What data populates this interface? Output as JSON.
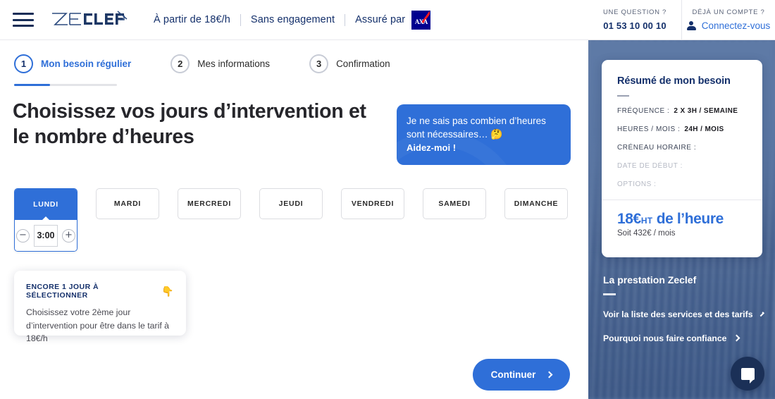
{
  "header": {
    "logo_text": "ZECLEF",
    "menu_icon": "hamburger-icon",
    "links": [
      "À partir de 18€/h",
      "Sans engagement",
      "Assuré par"
    ],
    "insurer": "AXA",
    "right": {
      "question_label": "UNE QUESTION ?",
      "phone": "01 53 10 00 10",
      "account_label": "DÉJÀ UN COMPTE ?",
      "login_label": "Connectez-vous"
    }
  },
  "stepper": {
    "steps": [
      {
        "number": "1",
        "label": "Mon besoin régulier",
        "active": true
      },
      {
        "number": "2",
        "label": "Mes informations",
        "active": false
      },
      {
        "number": "3",
        "label": "Confirmation",
        "active": false
      }
    ],
    "progress_percent": 35
  },
  "main": {
    "headline": "Choisissez vos jours d’intervention et le nombre d’heures",
    "help_bubble": {
      "text": "Je ne sais pas combien d’heures sont nécessaires…",
      "emoji": "🤔",
      "cta": "Aidez-moi !"
    },
    "days": [
      {
        "label": "LUNDI",
        "selected": true,
        "hours": "3:00"
      },
      {
        "label": "MARDI",
        "selected": false
      },
      {
        "label": "MERCREDI",
        "selected": false
      },
      {
        "label": "JEUDI",
        "selected": false
      },
      {
        "label": "VENDREDI",
        "selected": false
      },
      {
        "label": "SAMEDI",
        "selected": false
      },
      {
        "label": "DIMANCHE",
        "selected": false
      }
    ],
    "stepper_minus": "−",
    "stepper_plus": "+",
    "info_card": {
      "title": "ENCORE 1 JOUR À SÉLECTIONNER",
      "emoji": "👇",
      "body": "Choisissez votre 2ème jour d’intervention pour être dans le tarif à 18€/h"
    },
    "continue_label": "Continuer"
  },
  "sidebar": {
    "summary": {
      "title": "Résumé de mon besoin",
      "rows": [
        {
          "key": "FRÉQUENCE :",
          "value": "2 X 3H / SEMAINE",
          "muted": false
        },
        {
          "key": "HEURES / MOIS :",
          "value": "24H / MOIS",
          "muted": false
        },
        {
          "key": "CRÉNEAU HORAIRE :",
          "value": "",
          "muted": false
        },
        {
          "key": "DATE DE DÉBUT :",
          "value": "",
          "muted": true
        },
        {
          "key": "OPTIONS :",
          "value": "",
          "muted": true
        }
      ],
      "price_amount": "18€",
      "price_tax": "HT",
      "price_unit": "de l’heure",
      "price_sub": "Soit 432€ / mois"
    },
    "presta": {
      "title": "La prestation Zeclef",
      "links": [
        "Voir la liste des services et des tarifs",
        "Pourquoi nous faire confiance"
      ]
    },
    "chat_icon": "chat-bubble-icon"
  },
  "colors": {
    "accent": "#2f6fd8",
    "navy": "#14306b",
    "sidebar": "#5a76a3"
  }
}
